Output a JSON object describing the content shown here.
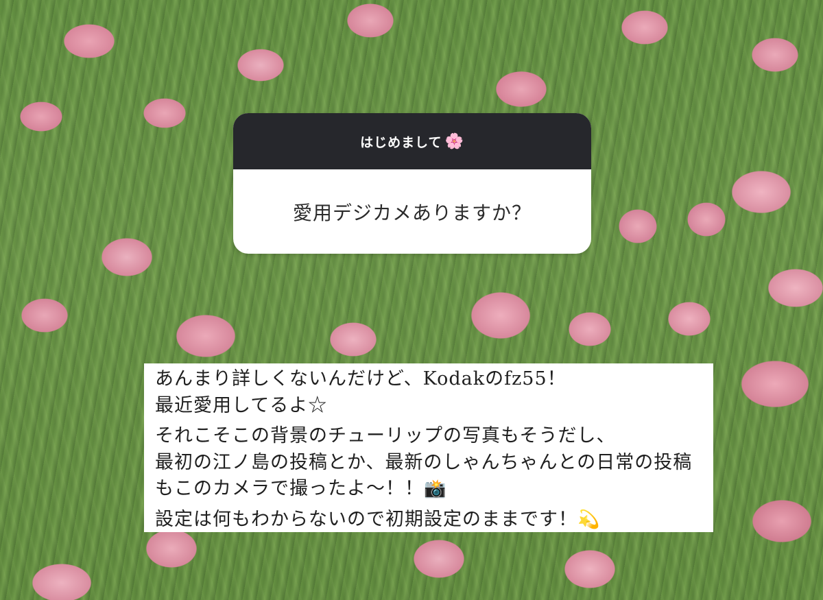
{
  "question": {
    "header": "はじめまして",
    "header_emoji": "🌸",
    "text": "愛用デジカメありますか？"
  },
  "answer": {
    "lines": [
      "あんまり詳しくないんだけど、Kodakのfz55！",
      "最近愛用してるよ☆",
      "それこそこの背景のチューリップの写真もそうだし、",
      "最初の江ノ島の投稿とか、最新のしゃんちゃんとの日常の投稿",
      "もこのカメラで撮ったよ〜！！",
      "設定は何もわからないので初期設定のままです！"
    ],
    "camera_emoji": "📸",
    "sparkle_emoji": "💫"
  },
  "background": {
    "description_colors": {
      "tulip": "#e9a6b5",
      "leaf": "#6f9a4e"
    }
  }
}
